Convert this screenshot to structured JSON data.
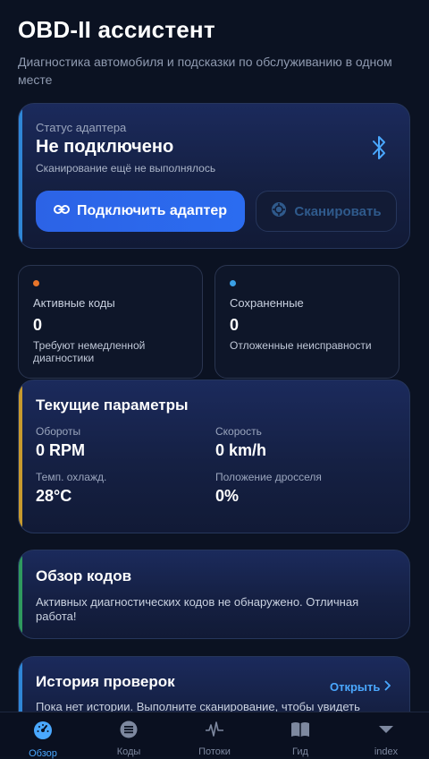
{
  "header": {
    "title": "OBD-II ассистент",
    "subtitle": "Диагностика автомобиля и подсказки по обслуживанию в одном месте"
  },
  "adapter": {
    "label": "Статус адаптера",
    "status": "Не подключено",
    "scan_status": "Сканирование ещё не выполнялось",
    "connect_button": "Подключить адаптер",
    "scan_button": "Сканировать",
    "accent": "#2f86d6"
  },
  "stats": [
    {
      "title": "Активные коды",
      "value": "0",
      "desc": "Требуют немедленной диагностики",
      "dot": "#e8752a"
    },
    {
      "title": "Сохраненные",
      "value": "0",
      "desc": "Отложенные неисправности",
      "dot": "#3aa0e6"
    }
  ],
  "params": {
    "title": "Текущие параметры",
    "accent": "#c79a2e",
    "items": [
      {
        "label": "Обороты",
        "value": "0 RPM"
      },
      {
        "label": "Скорость",
        "value": "0 km/h"
      },
      {
        "label": "Темп. охлажд.",
        "value": "28°C"
      },
      {
        "label": "Положение дросселя",
        "value": "0%"
      }
    ]
  },
  "codes": {
    "title": "Обзор кодов",
    "text": "Активных диагностических кодов не обнаружено. Отличная работа!",
    "accent": "#2f9a5e"
  },
  "history": {
    "title": "История проверок",
    "open_link": "Открыть",
    "text": "Пока нет истории. Выполните сканирование, чтобы увидеть",
    "accent": "#2f86d6"
  },
  "tabs": [
    {
      "label": "Обзор",
      "icon": "gauge-icon",
      "active": true
    },
    {
      "label": "Коды",
      "icon": "list-icon",
      "active": false
    },
    {
      "label": "Потоки",
      "icon": "pulse-icon",
      "active": false
    },
    {
      "label": "Гид",
      "icon": "book-icon",
      "active": false
    },
    {
      "label": "index",
      "icon": "triangle-down-icon",
      "active": false
    }
  ]
}
